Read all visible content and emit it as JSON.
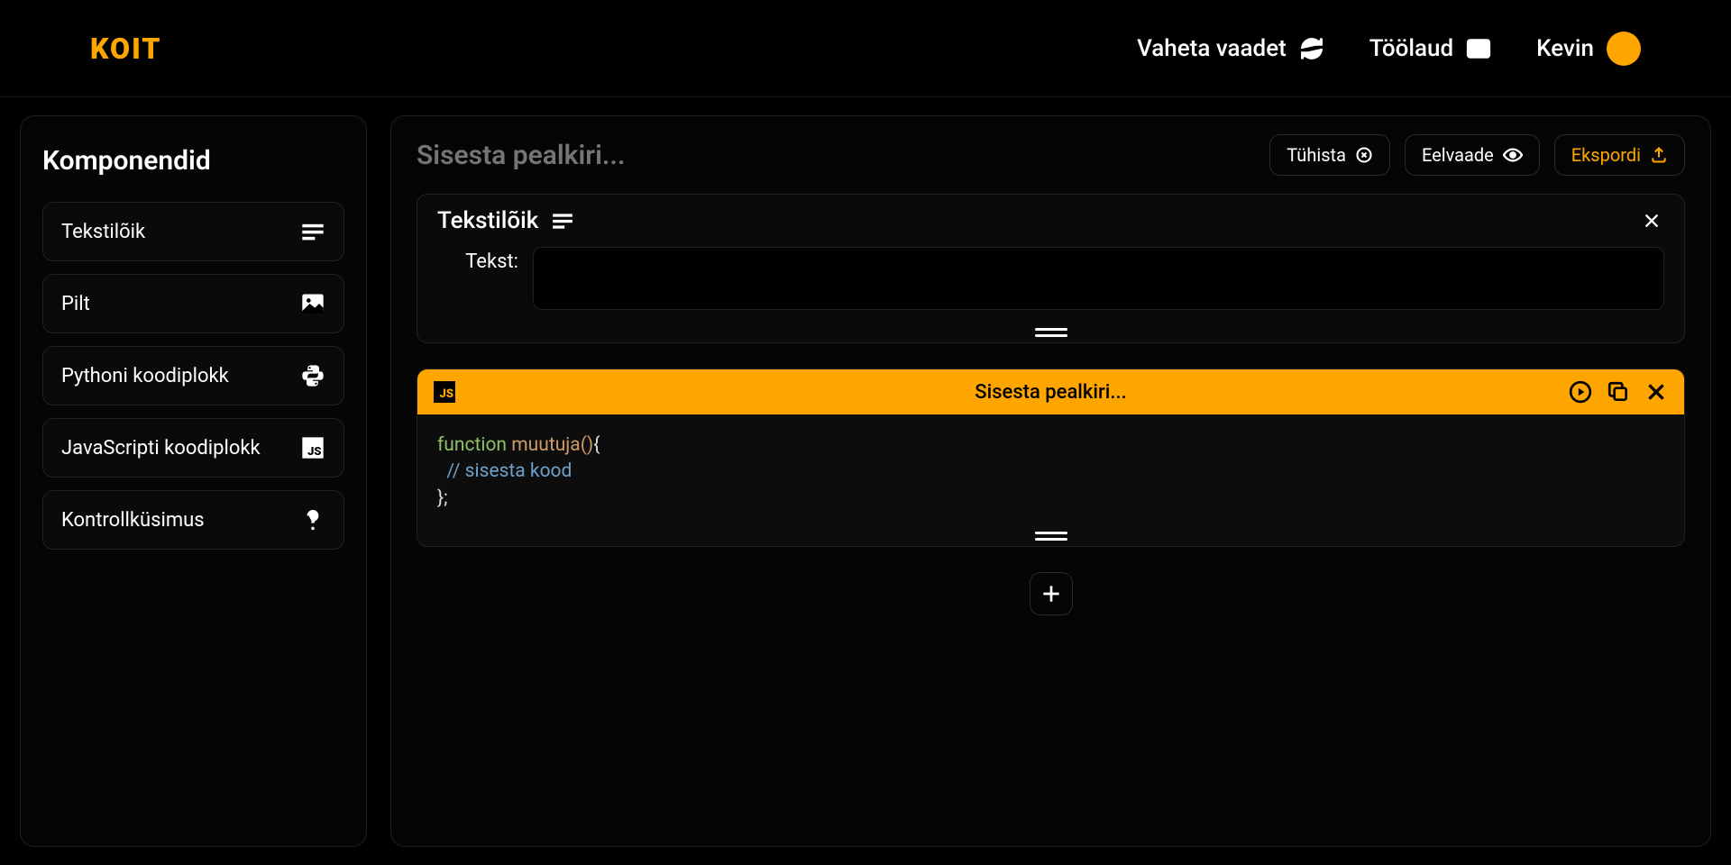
{
  "logo": "KOIT",
  "header": {
    "switch_view": "Vaheta vaadet",
    "dashboard": "Töölaud",
    "username": "Kevin"
  },
  "sidebar": {
    "title": "Komponendid",
    "items": [
      {
        "label": "Tekstilõik",
        "icon": "text-lines-icon"
      },
      {
        "label": "Pilt",
        "icon": "image-icon"
      },
      {
        "label": "Pythoni koodiplokk",
        "icon": "python-icon"
      },
      {
        "label": "JavaScripti koodiplokk",
        "icon": "js-icon"
      },
      {
        "label": "Kontrollküsimus",
        "icon": "question-icon"
      }
    ]
  },
  "content": {
    "title_placeholder": "Sisesta pealkiri...",
    "actions": {
      "cancel": "Tühista",
      "preview": "Eelvaade",
      "export": "Ekspordi"
    },
    "text_block": {
      "title": "Tekstilõik",
      "field_label": "Tekst:",
      "value": ""
    },
    "code_block": {
      "badge": "JS",
      "title_placeholder": "Sisesta pealkiri...",
      "code": {
        "line1_kw": "function",
        "line1_fn": "muutuja",
        "line1_paren": "()",
        "line1_brace": "{",
        "line2_comment": "// sisesta kood",
        "line3": "};"
      }
    }
  }
}
